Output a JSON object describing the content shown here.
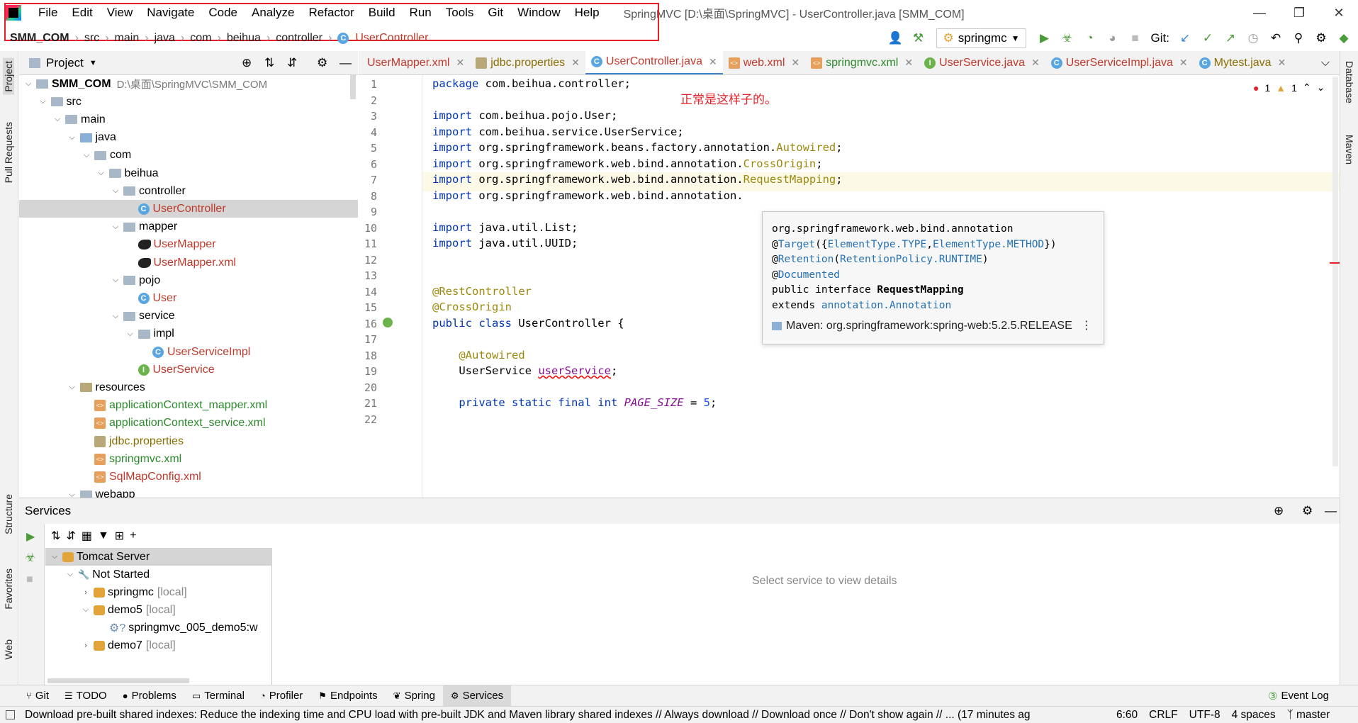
{
  "window": {
    "title": "SpringMVC [D:\\桌面\\SpringMVC] - UserController.java [SMM_COM]",
    "menu": [
      "File",
      "Edit",
      "View",
      "Navigate",
      "Code",
      "Analyze",
      "Refactor",
      "Build",
      "Run",
      "Tools",
      "Git",
      "Window",
      "Help"
    ]
  },
  "breadcrumb": [
    "SMM_COM",
    "src",
    "main",
    "java",
    "com",
    "beihua",
    "controller",
    "UserController"
  ],
  "toolbar": {
    "run_config": "springmc",
    "git_label": "Git:"
  },
  "project": {
    "title": "Project",
    "tree": [
      {
        "label": "SMM_COM",
        "extra": "D:\\桌面\\SpringMVC\\SMM_COM",
        "depth": 0,
        "type": "module",
        "bold": true,
        "open": true
      },
      {
        "label": "src",
        "depth": 1,
        "type": "folder",
        "open": true
      },
      {
        "label": "main",
        "depth": 2,
        "type": "folder",
        "open": true
      },
      {
        "label": "java",
        "depth": 3,
        "type": "src",
        "open": true
      },
      {
        "label": "com",
        "depth": 4,
        "type": "folder",
        "open": true
      },
      {
        "label": "beihua",
        "depth": 5,
        "type": "folder",
        "open": true
      },
      {
        "label": "controller",
        "depth": 6,
        "type": "folder",
        "open": true
      },
      {
        "label": "UserController",
        "depth": 7,
        "type": "class",
        "color": "#c0392b",
        "selected": true
      },
      {
        "label": "mapper",
        "depth": 6,
        "type": "folder",
        "open": true
      },
      {
        "label": "UserMapper",
        "depth": 7,
        "type": "bird",
        "color": "#c0392b"
      },
      {
        "label": "UserMapper.xml",
        "depth": 7,
        "type": "bird",
        "color": "#c0392b"
      },
      {
        "label": "pojo",
        "depth": 6,
        "type": "folder",
        "open": true
      },
      {
        "label": "User",
        "depth": 7,
        "type": "class",
        "color": "#c0392b"
      },
      {
        "label": "service",
        "depth": 6,
        "type": "folder",
        "open": true
      },
      {
        "label": "impl",
        "depth": 7,
        "type": "folder",
        "open": true
      },
      {
        "label": "UserServiceImpl",
        "depth": 8,
        "type": "class",
        "color": "#c0392b"
      },
      {
        "label": "UserService",
        "depth": 7,
        "type": "interface",
        "color": "#c0392b"
      },
      {
        "label": "resources",
        "depth": 3,
        "type": "res",
        "open": true
      },
      {
        "label": "applicationContext_mapper.xml",
        "depth": 4,
        "type": "xml",
        "color": "#2b8a2b"
      },
      {
        "label": "applicationContext_service.xml",
        "depth": 4,
        "type": "xml",
        "color": "#2b8a2b"
      },
      {
        "label": "jdbc.properties",
        "depth": 4,
        "type": "prop",
        "color": "#8a6d00"
      },
      {
        "label": "springmvc.xml",
        "depth": 4,
        "type": "xml",
        "color": "#2b8a2b"
      },
      {
        "label": "SqlMapConfig.xml",
        "depth": 4,
        "type": "xml",
        "color": "#c0392b"
      },
      {
        "label": "webapp",
        "depth": 3,
        "type": "folder",
        "open": true
      }
    ]
  },
  "tabs": [
    {
      "label": "UserMapper.xml",
      "color": "#c0392b",
      "icon": "xml"
    },
    {
      "label": "jdbc.properties",
      "color": "#8a6d00",
      "icon": "prop"
    },
    {
      "label": "UserController.java",
      "color": "#c0392b",
      "icon": "class",
      "active": true
    },
    {
      "label": "web.xml",
      "color": "#c0392b",
      "icon": "xml"
    },
    {
      "label": "springmvc.xml",
      "color": "#2b8a2b",
      "icon": "xml"
    },
    {
      "label": "UserService.java",
      "color": "#c0392b",
      "icon": "interface"
    },
    {
      "label": "UserServiceImpl.java",
      "color": "#c0392b",
      "icon": "class"
    },
    {
      "label": "Mytest.java",
      "color": "#8a6d00",
      "icon": "class"
    }
  ],
  "inspections": {
    "errors": "1",
    "warnings": "1"
  },
  "code": [
    {
      "n": "1",
      "seg": [
        [
          "kw",
          "package"
        ],
        [
          "cn",
          " com.beihua.controller;"
        ]
      ]
    },
    {
      "n": "2",
      "seg": []
    },
    {
      "n": "3",
      "seg": [
        [
          "kw",
          "import"
        ],
        [
          "cn",
          " com.beihua.pojo.User;"
        ]
      ]
    },
    {
      "n": "4",
      "seg": [
        [
          "kw",
          "import"
        ],
        [
          "cn",
          " com.beihua.service.UserService;"
        ]
      ]
    },
    {
      "n": "5",
      "seg": [
        [
          "kw",
          "import"
        ],
        [
          "cn",
          " org.springframework.beans.factory.annotation."
        ],
        [
          "ann",
          "Autowired"
        ],
        [
          "cn",
          ";"
        ]
      ]
    },
    {
      "n": "6",
      "seg": [
        [
          "kw",
          "import"
        ],
        [
          "cn",
          " org.springframework.web.bind.annotation."
        ],
        [
          "ann",
          "CrossOrigin"
        ],
        [
          "cn",
          ";"
        ]
      ]
    },
    {
      "n": "7",
      "seg": [
        [
          "kw",
          "import"
        ],
        [
          "cn",
          " org.springframework.web.bind.annotation."
        ],
        [
          "ann",
          "RequestMapping"
        ],
        [
          "cn",
          ";"
        ]
      ]
    },
    {
      "n": "8",
      "seg": [
        [
          "kw",
          "import"
        ],
        [
          "cn",
          " org.springframework.web.bind.annotation."
        ]
      ]
    },
    {
      "n": "9",
      "seg": []
    },
    {
      "n": "10",
      "seg": [
        [
          "kw",
          "import"
        ],
        [
          "cn",
          " java.util.List;"
        ]
      ]
    },
    {
      "n": "11",
      "seg": [
        [
          "kw",
          "import"
        ],
        [
          "cn",
          " java.util.UUID;"
        ]
      ]
    },
    {
      "n": "12",
      "seg": []
    },
    {
      "n": "13",
      "seg": []
    },
    {
      "n": "14",
      "seg": [
        [
          "ann",
          "@RestController"
        ]
      ]
    },
    {
      "n": "15",
      "seg": [
        [
          "ann",
          "@CrossOrigin"
        ]
      ]
    },
    {
      "n": "16",
      "seg": [
        [
          "kw",
          "public class"
        ],
        [
          "cn",
          " UserController {"
        ]
      ]
    },
    {
      "n": "17",
      "seg": []
    },
    {
      "n": "18",
      "seg": [
        [
          "cn",
          "    "
        ],
        [
          "ann",
          "@Autowired"
        ]
      ]
    },
    {
      "n": "19",
      "seg": [
        [
          "cn",
          "    UserService "
        ],
        [
          "err",
          "userService"
        ],
        [
          "cn",
          ";"
        ]
      ]
    },
    {
      "n": "20",
      "seg": []
    },
    {
      "n": "21",
      "seg": [
        [
          "cn",
          "    "
        ],
        [
          "kw",
          "private static final int"
        ],
        [
          "cn",
          " "
        ],
        [
          "const",
          "PAGE_SIZE"
        ],
        [
          "cn",
          " = "
        ],
        [
          "num",
          "5"
        ],
        [
          "cn",
          ";"
        ]
      ]
    },
    {
      "n": "22",
      "seg": []
    }
  ],
  "annotation_note": "正常是这样子的。",
  "popup": {
    "pkg": "org.springframework.web.bind.annotation",
    "l2a": "@",
    "l2b": "Target",
    "l2c": "({",
    "l2d": "ElementType.TYPE",
    "l2e": ",",
    "l2f": "ElementType.METHOD",
    "l2g": "})",
    "l3a": "@",
    "l3b": "Retention",
    "l3c": "(",
    "l3d": "RetentionPolicy.RUNTIME",
    "l3e": ")",
    "l4a": "@",
    "l4b": "Documented",
    "l5a": "public interface ",
    "l5b": "RequestMapping",
    "l6a": "extends ",
    "l6b": "annotation.Annotation",
    "maven": "Maven: org.springframework:spring-web:5.2.5.RELEASE"
  },
  "services": {
    "title": "Services",
    "detail": "Select service to view details",
    "tree": [
      {
        "label": "Tomcat Server",
        "depth": 0,
        "open": true,
        "selected": true
      },
      {
        "label": "Not Started",
        "depth": 1,
        "open": true,
        "icon": "wrench"
      },
      {
        "label": "springmc",
        "extra": "[local]",
        "depth": 2,
        "open": false
      },
      {
        "label": "demo5",
        "extra": "[local]",
        "depth": 2,
        "open": true
      },
      {
        "label": "springmvc_005_demo5:w",
        "depth": 3,
        "icon": "artifact"
      },
      {
        "label": "demo7",
        "extra": "[local]",
        "depth": 2,
        "open": false
      }
    ]
  },
  "left_strip": [
    "Project",
    "Pull Requests",
    "Structure",
    "Favorites",
    "Web"
  ],
  "right_strip": [
    "Database",
    "Maven"
  ],
  "bottom_tabs": [
    "Git",
    "TODO",
    "Problems",
    "Terminal",
    "Profiler",
    "Endpoints",
    "Spring",
    "Services"
  ],
  "event_log": "Event Log",
  "status": {
    "message": "Download pre-built shared indexes: Reduce the indexing time and CPU load with pre-built JDK and Maven library shared indexes // Always download // Download once // Don't show again // ... (17 minutes ag",
    "position": "6:60",
    "line_sep": "CRLF",
    "encoding": "UTF-8",
    "indent": "4 spaces",
    "branch": "master"
  },
  "colors": {
    "accent": "#4083c9",
    "highlight_box": "#e5202a"
  }
}
